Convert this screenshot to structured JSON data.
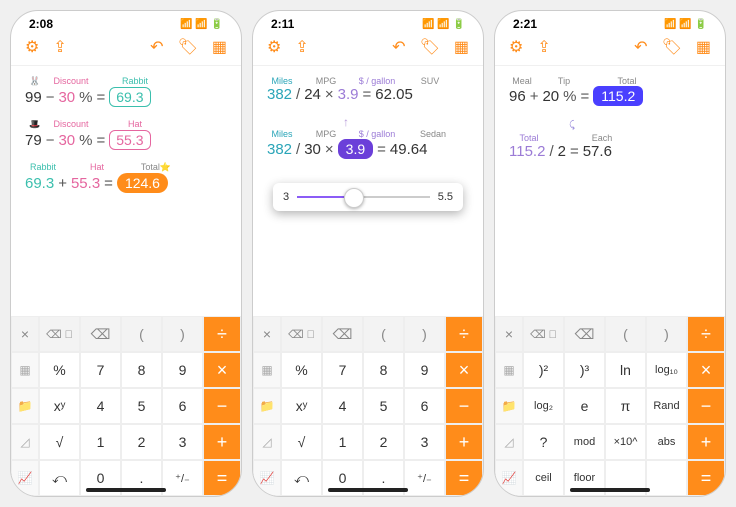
{
  "phones": [
    {
      "time": "2:08",
      "rows": [
        {
          "labels": [
            {
              "t": "🐰",
              "w": 20
            },
            {
              "t": "Discount",
              "w": 44,
              "c": "txt-pink"
            },
            {
              "t": "",
              "w": 14
            },
            {
              "t": "Rabbit",
              "w": 40,
              "c": "txt-teal"
            }
          ],
          "vals": [
            {
              "t": "99"
            },
            {
              "t": "−",
              "op": 1
            },
            {
              "t": "30",
              "c": "txt-pink"
            },
            {
              "t": "%",
              "op": 1
            },
            {
              "t": "=",
              "op": 1
            },
            {
              "t": "69.3",
              "pill": "pill-teal"
            }
          ]
        },
        {
          "labels": [
            {
              "t": "🎩",
              "w": 20
            },
            {
              "t": "Discount",
              "w": 44,
              "c": "txt-pink"
            },
            {
              "t": "",
              "w": 14
            },
            {
              "t": "Hat",
              "w": 40,
              "c": "txt-pink"
            }
          ],
          "vals": [
            {
              "t": "79"
            },
            {
              "t": "−",
              "op": 1
            },
            {
              "t": "30",
              "c": "txt-pink"
            },
            {
              "t": "%",
              "op": 1
            },
            {
              "t": "=",
              "op": 1
            },
            {
              "t": "55.3",
              "pill": "pill-pink"
            }
          ]
        },
        {
          "labels": [
            {
              "t": "Rabbit",
              "w": 36,
              "c": "txt-teal"
            },
            {
              "t": "",
              "w": 10
            },
            {
              "t": "Hat",
              "w": 36,
              "c": "txt-pink"
            },
            {
              "t": "",
              "w": 10
            },
            {
              "t": "Total⭐",
              "w": 46,
              "c": "txt-gray"
            }
          ],
          "vals": [
            {
              "t": "69.3",
              "c": "txt-teal"
            },
            {
              "t": "+",
              "op": 1
            },
            {
              "t": "55.3",
              "c": "txt-pink"
            },
            {
              "t": "=",
              "op": 1
            },
            {
              "t": "124.6",
              "pill": "pill-orange"
            }
          ]
        }
      ],
      "keys": "std"
    },
    {
      "time": "2:11",
      "rows": [
        {
          "labels": [
            {
              "t": "Miles",
              "w": 30,
              "c": "txt-green"
            },
            {
              "t": "",
              "w": 8
            },
            {
              "t": "MPG",
              "w": 26,
              "c": "txt-gray"
            },
            {
              "t": "",
              "w": 8
            },
            {
              "t": "$ / gallon",
              "w": 44,
              "c": "txt-purple"
            },
            {
              "t": "",
              "w": 8
            },
            {
              "t": "SUV",
              "w": 30,
              "c": "txt-gray"
            }
          ],
          "vals": [
            {
              "t": "382",
              "c": "txt-green"
            },
            {
              "t": "/",
              "op": 1
            },
            {
              "t": "24"
            },
            {
              "t": "×",
              "op": 1
            },
            {
              "t": "3.9",
              "c": "txt-purple"
            },
            {
              "t": "=",
              "op": 1
            },
            {
              "t": "62.05"
            }
          ]
        },
        {
          "arrow_up": "↑"
        },
        {
          "labels": [
            {
              "t": "Miles",
              "w": 30,
              "c": "txt-green"
            },
            {
              "t": "",
              "w": 8
            },
            {
              "t": "MPG",
              "w": 26,
              "c": "txt-gray"
            },
            {
              "t": "",
              "w": 8
            },
            {
              "t": "$ / gallon",
              "w": 44,
              "c": "txt-purple"
            },
            {
              "t": "",
              "w": 8
            },
            {
              "t": "Sedan",
              "w": 36,
              "c": "txt-gray"
            }
          ],
          "vals": [
            {
              "t": "382",
              "c": "txt-green"
            },
            {
              "t": "/",
              "op": 1
            },
            {
              "t": "30"
            },
            {
              "t": "×",
              "op": 1
            },
            {
              "t": "3.9",
              "pill": "pill-purple"
            },
            {
              "t": "=",
              "op": 1
            },
            {
              "t": "49.64"
            }
          ]
        }
      ],
      "slider": {
        "min": "3",
        "max": "5.5"
      },
      "keys": "std"
    },
    {
      "time": "2:21",
      "rows": [
        {
          "labels": [
            {
              "t": "Meal",
              "w": 26,
              "c": "txt-gray"
            },
            {
              "t": "",
              "w": 10
            },
            {
              "t": "Tip",
              "w": 22,
              "c": "txt-gray"
            },
            {
              "t": "",
              "w": 24
            },
            {
              "t": "Total",
              "w": 40,
              "c": "txt-gray"
            }
          ],
          "vals": [
            {
              "t": "96"
            },
            {
              "t": "+",
              "op": 1
            },
            {
              "t": "20"
            },
            {
              "t": "%",
              "op": 1
            },
            {
              "t": "=",
              "op": 1
            },
            {
              "t": "115.2",
              "pill": "pill-blue"
            }
          ]
        },
        {
          "arrow_link": "↙"
        },
        {
          "labels": [
            {
              "t": "Total",
              "w": 40,
              "c": "txt-purple"
            },
            {
              "t": "",
              "w": 30
            },
            {
              "t": "Each",
              "w": 30,
              "c": "txt-gray"
            }
          ],
          "vals": [
            {
              "t": "115.2",
              "c": "txt-purple"
            },
            {
              "t": "/",
              "op": 1
            },
            {
              "t": "2"
            },
            {
              "t": "=",
              "op": 1
            },
            {
              "t": "57.6"
            }
          ]
        }
      ],
      "keys": "sci"
    }
  ],
  "keypad_std": {
    "top": [
      "×",
      "⌫ ⃞",
      "⌫",
      "(",
      ")",
      "÷"
    ],
    "r1": [
      "▦",
      "%",
      "7",
      "8",
      "9",
      "×"
    ],
    "r2": [
      "📁",
      "xʸ",
      "4",
      "5",
      "6",
      "−"
    ],
    "r3": [
      "◿",
      "√",
      "1",
      "2",
      "3",
      "+"
    ],
    "r4": [
      "📈",
      "⤺",
      "0",
      ".",
      "⁺/₋",
      "="
    ]
  },
  "keypad_sci": {
    "top": [
      "×",
      "⌫ ⃞",
      "⌫",
      "(",
      ")",
      "÷"
    ],
    "r1": [
      "▦",
      ")²",
      ")³",
      "ln",
      "log₁₀",
      "×"
    ],
    "r2": [
      "📁",
      "log₂",
      "e",
      "π",
      "Rand",
      "−"
    ],
    "r3": [
      "◿",
      "?",
      "mod",
      "×10^",
      "abs",
      "+"
    ],
    "r4": [
      "📈",
      "ceil",
      "floor",
      "",
      "",
      "="
    ]
  }
}
